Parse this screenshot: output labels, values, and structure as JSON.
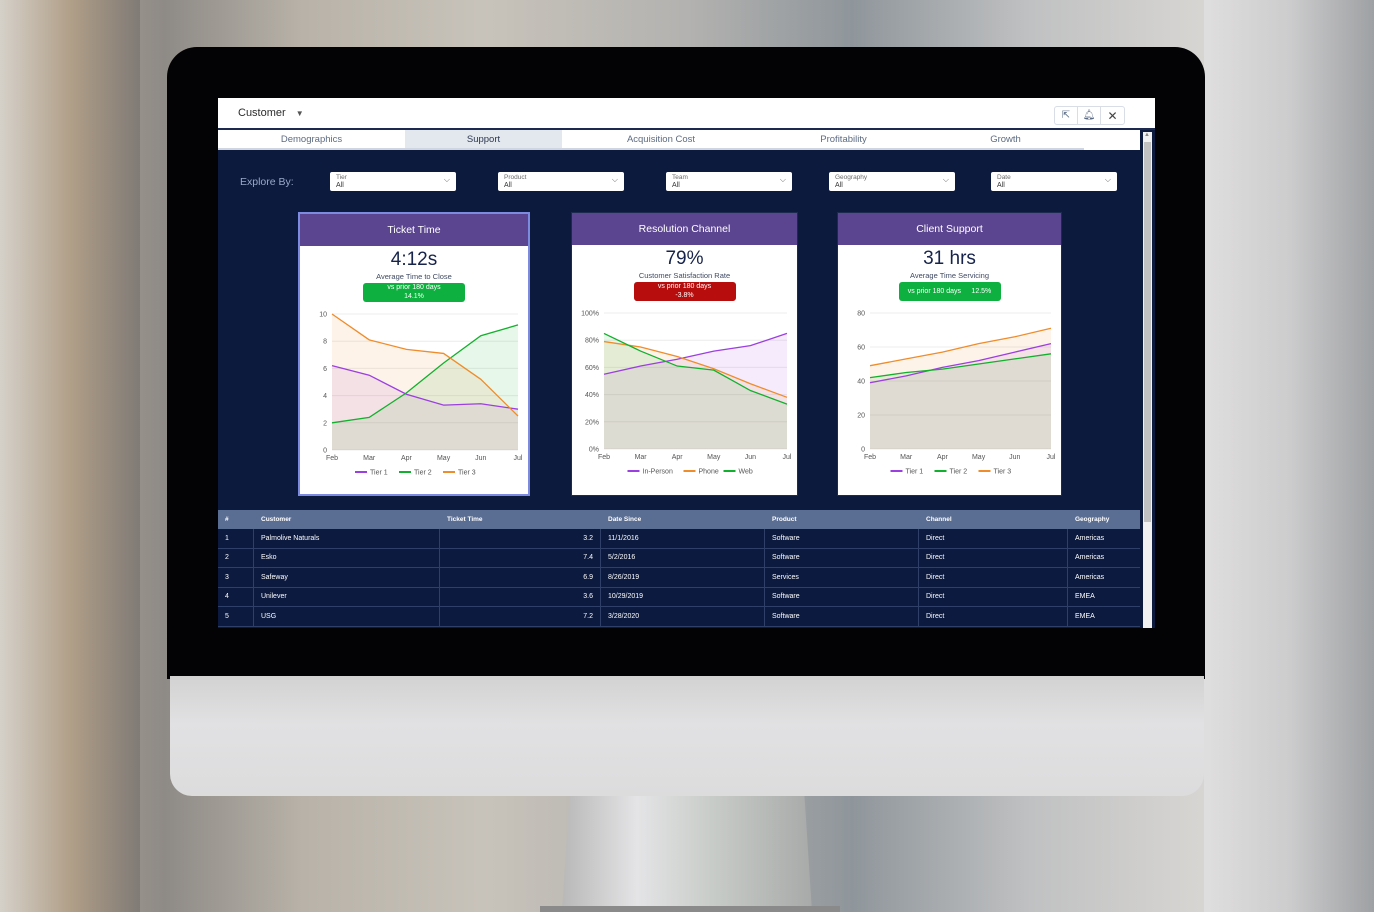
{
  "app": {
    "object_title": "Customer",
    "actions": [
      {
        "name": "share-icon",
        "glyph": "⇱"
      },
      {
        "name": "notify-icon",
        "glyph": "🔔"
      },
      {
        "name": "close-icon",
        "glyph": "✕"
      }
    ]
  },
  "tabs": [
    {
      "label": "Demographics",
      "active": false
    },
    {
      "label": "Support",
      "active": true
    },
    {
      "label": "Acquisition Cost",
      "active": false
    },
    {
      "label": "Profitability",
      "active": false
    },
    {
      "label": "Growth",
      "active": false
    }
  ],
  "filters": {
    "label": "Explore By:",
    "items": [
      {
        "label": "Tier",
        "value": "All"
      },
      {
        "label": "Product",
        "value": "All"
      },
      {
        "label": "Team",
        "value": "All"
      },
      {
        "label": "Geography",
        "value": "All"
      },
      {
        "label": "Date",
        "value": "All"
      }
    ]
  },
  "colors": {
    "header_purple": "#5b4590",
    "navy": "#0b1a3d",
    "good": "#0eb13f",
    "bad": "#b70d0d",
    "purple": "#9b3fe0",
    "green": "#12b02c",
    "orange": "#ef8c2b"
  },
  "cards": [
    {
      "title": "Ticket Time",
      "kpi": "4:12s",
      "kpi_label": "Average Time to Close",
      "badge_line1": "vs prior 180 days",
      "badge_line2": "14.1%",
      "badge_status": "positive"
    },
    {
      "title": "Resolution Channel",
      "kpi": "79%",
      "kpi_label": "Customer Satisfaction Rate",
      "badge_line1": "vs prior 180 days",
      "badge_line2": "-3.8%",
      "badge_status": "negative"
    },
    {
      "title": "Client Support",
      "kpi": "31 hrs",
      "kpi_label": "Average Time Servicing",
      "badge_line1": "vs prior 180 days",
      "badge_line2": "12.5%",
      "badge_status": "positive"
    }
  ],
  "chart_data": [
    {
      "type": "area",
      "title": "Ticket Time",
      "categories": [
        "Feb",
        "Mar",
        "Apr",
        "May",
        "Jun",
        "Jul"
      ],
      "ylim": [
        0,
        10
      ],
      "yticks": [
        "0",
        "2",
        "4",
        "6",
        "8",
        "10"
      ],
      "series": [
        {
          "name": "Tier 1",
          "color": "#9b3fe0",
          "values": [
            6.2,
            5.5,
            4.1,
            3.3,
            3.4,
            3.0
          ]
        },
        {
          "name": "Tier 2",
          "color": "#12b02c",
          "values": [
            2.0,
            2.4,
            4.2,
            6.4,
            8.4,
            9.2
          ]
        },
        {
          "name": "Tier 3",
          "color": "#ef8c2b",
          "values": [
            10.0,
            8.1,
            7.4,
            7.1,
            5.2,
            2.5
          ]
        }
      ],
      "legend": "bottom"
    },
    {
      "type": "area",
      "title": "Resolution Channel",
      "categories": [
        "Feb",
        "Mar",
        "Apr",
        "May",
        "Jun",
        "Jul"
      ],
      "ylim": [
        0,
        100
      ],
      "yticks": [
        "0%",
        "20%",
        "40%",
        "60%",
        "80%",
        "100%"
      ],
      "series": [
        {
          "name": "In-Person",
          "color": "#9b3fe0",
          "values": [
            55,
            61,
            66,
            72,
            76,
            85
          ]
        },
        {
          "name": "Phone",
          "color": "#ef8c2b",
          "values": [
            79,
            75,
            68,
            59,
            48,
            38
          ]
        },
        {
          "name": "Web",
          "color": "#12b02c",
          "values": [
            85,
            72,
            61,
            58,
            43,
            33
          ]
        }
      ],
      "legend": "bottom"
    },
    {
      "type": "area",
      "title": "Client Support",
      "categories": [
        "Feb",
        "Mar",
        "Apr",
        "May",
        "Jun",
        "Jul"
      ],
      "ylim": [
        0,
        80
      ],
      "yticks": [
        "0",
        "20",
        "40",
        "60",
        "80"
      ],
      "series": [
        {
          "name": "Tier 1",
          "color": "#9b3fe0",
          "values": [
            39,
            43,
            48,
            52,
            57,
            62
          ]
        },
        {
          "name": "Tier 2",
          "color": "#12b02c",
          "values": [
            42,
            45,
            47,
            50,
            53,
            56
          ]
        },
        {
          "name": "Tier 3",
          "color": "#ef8c2b",
          "values": [
            49,
            53,
            57,
            62,
            66,
            71
          ]
        }
      ],
      "legend": "bottom"
    }
  ],
  "table": {
    "columns": [
      "#",
      "Customer",
      "Ticket Time",
      "Date Since",
      "Product",
      "Channel",
      "Geography"
    ],
    "rows": [
      [
        "1",
        "Palmolive Naturals",
        "3.2",
        "11/1/2016",
        "Software",
        "Direct",
        "Americas"
      ],
      [
        "2",
        "Esko",
        "7.4",
        "5/2/2016",
        "Software",
        "Direct",
        "Americas"
      ],
      [
        "3",
        "Safeway",
        "6.9",
        "8/26/2019",
        "Services",
        "Direct",
        "Americas"
      ],
      [
        "4",
        "Unilever",
        "3.6",
        "10/29/2019",
        "Software",
        "Direct",
        "EMEA"
      ],
      [
        "5",
        "USG",
        "7.2",
        "3/28/2020",
        "Software",
        "Direct",
        "EMEA"
      ]
    ]
  }
}
